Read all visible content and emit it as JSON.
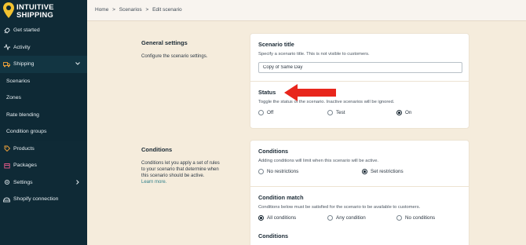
{
  "brand": {
    "line1": "INTUITIVE",
    "line2": "SHIPPING"
  },
  "sidebar": {
    "items": [
      {
        "label": "Get started",
        "icon": "rocket-icon"
      },
      {
        "label": "Activity",
        "icon": "activity-icon"
      },
      {
        "label": "Shipping",
        "icon": "truck-icon"
      },
      {
        "label": "Scenarios"
      },
      {
        "label": "Zones"
      },
      {
        "label": "Rate blending"
      },
      {
        "label": "Condition groups"
      },
      {
        "label": "Products",
        "icon": "tag-icon"
      },
      {
        "label": "Packages",
        "icon": "package-icon"
      },
      {
        "label": "Settings",
        "icon": "gear-icon"
      },
      {
        "label": "Shopify connection",
        "icon": "connection-icon"
      }
    ]
  },
  "breadcrumb": {
    "home": "Home",
    "sep1": ">",
    "scenarios": "Scenarios",
    "sep2": ">",
    "current": "Edit scenario"
  },
  "general": {
    "title": "General settings",
    "desc": "Configure the scenario settings.",
    "scenario_title": {
      "label": "Scenario title",
      "desc": "Specify a scenario title. This is not visible to customers.",
      "value": "Copy of Same Day"
    },
    "status": {
      "label": "Status",
      "desc": "Toggle the status of the scenario. Inactive scenarios will be ignored.",
      "options": [
        "Off",
        "Test",
        "On"
      ],
      "selected": "On"
    }
  },
  "conditions_section": {
    "title": "Conditions",
    "desc_lines": [
      "Conditions let you apply a set of rules",
      "to your scenario that determine when",
      "this scenario should be active."
    ],
    "learn_more": "Learn more.",
    "conditions": {
      "label": "Conditions",
      "desc": "Adding conditions will limit when this scenario will be active.",
      "options": [
        "No restrictions",
        "Set restrictions"
      ],
      "selected": "Set restrictions"
    },
    "condition_match": {
      "label": "Condition match",
      "desc": "Conditions below must be satisfied for the scenario to be available to customers.",
      "options": [
        "All conditions",
        "Any condition",
        "No conditions"
      ],
      "selected": "All conditions"
    },
    "conditions_sub_label": "Conditions"
  },
  "colors": {
    "sidebar_bg": "#0f2a36",
    "page_bg": "#f5ecdc",
    "accent_yellow": "#f2c230",
    "arrow_red": "#e8261c"
  }
}
